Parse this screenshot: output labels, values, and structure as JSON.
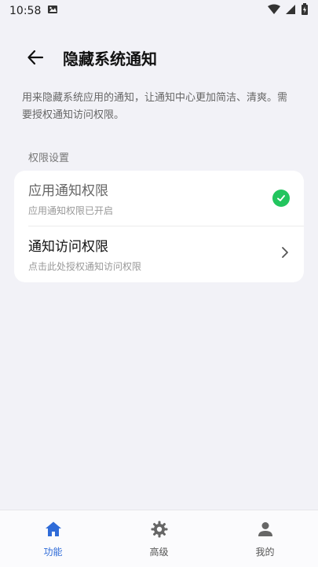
{
  "status_bar": {
    "time": "10:58"
  },
  "header": {
    "title": "隐藏系统通知"
  },
  "description": "用来隐藏系统应用的通知，让通知中心更加简洁、清爽。需要授权通知访问权限。",
  "section": {
    "label": "权限设置"
  },
  "permissions": [
    {
      "title": "应用通知权限",
      "subtitle": "应用通知权限已开启",
      "status": "granted"
    },
    {
      "title": "通知访问权限",
      "subtitle": "点击此处授权通知访问权限",
      "status": "pending"
    }
  ],
  "bottom_nav": {
    "items": [
      {
        "label": "功能",
        "icon": "home-icon",
        "active": true
      },
      {
        "label": "高级",
        "icon": "gear-icon",
        "active": false
      },
      {
        "label": "我的",
        "icon": "person-icon",
        "active": false
      }
    ]
  },
  "colors": {
    "accent": "#2f6bd8",
    "success": "#22c55e",
    "background": "#f2f2f7"
  }
}
